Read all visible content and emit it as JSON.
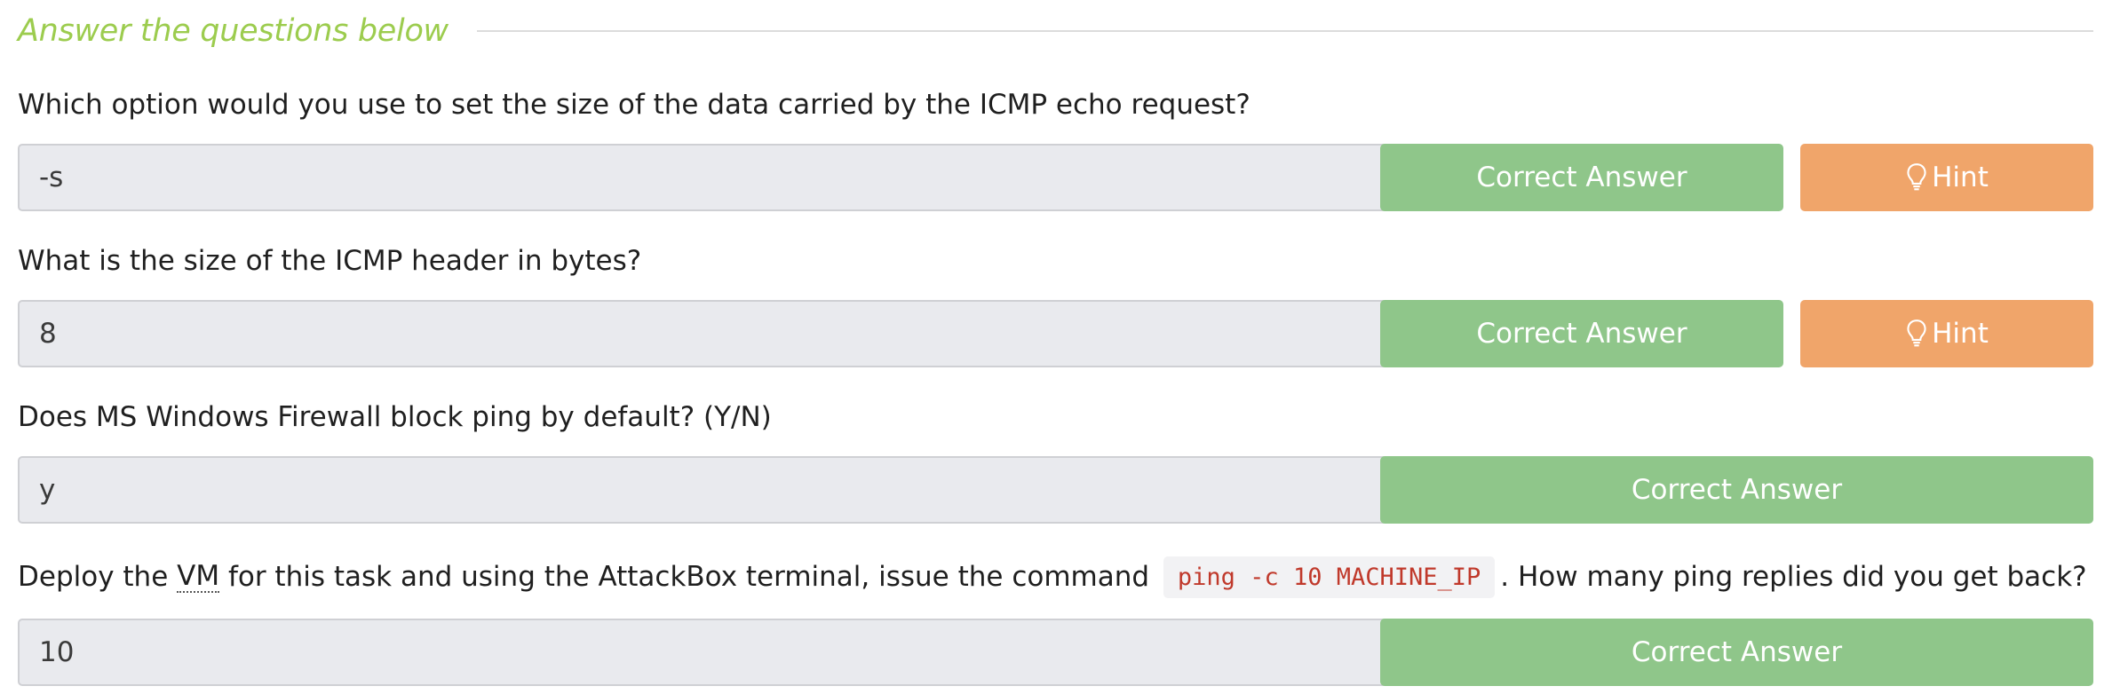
{
  "section": {
    "title": "Answer the questions below"
  },
  "questions": [
    {
      "text": "Which option would you use to set the size of the data carried by the ICMP echo request?",
      "answer": "-s",
      "correct_label": "Correct Answer",
      "hint_label": "Hint",
      "hint_icon": "lightbulb-icon"
    },
    {
      "text": "What is the size of the ICMP header in bytes?",
      "answer": "8",
      "correct_label": "Correct Answer",
      "hint_label": "Hint",
      "hint_icon": "lightbulb-icon"
    },
    {
      "text": "Does MS Windows Firewall block ping by default? (Y/N)",
      "answer": "y",
      "correct_label": "Correct Answer"
    },
    {
      "text_before": "Deploy the ",
      "abbr": "VM",
      "text_middle": " for this task and using the AttackBox terminal, issue the command ",
      "code": "ping -c 10 MACHINE_IP",
      "text_after": ". How many ping replies did you get back?",
      "answer": "10",
      "correct_label": "Correct Answer"
    }
  ],
  "colors": {
    "title_green": "#9ccc4e",
    "correct_green": "#8fc68a",
    "hint_orange": "#f0a56a",
    "input_bg": "#e9eaee",
    "code_red": "#c0392b"
  }
}
